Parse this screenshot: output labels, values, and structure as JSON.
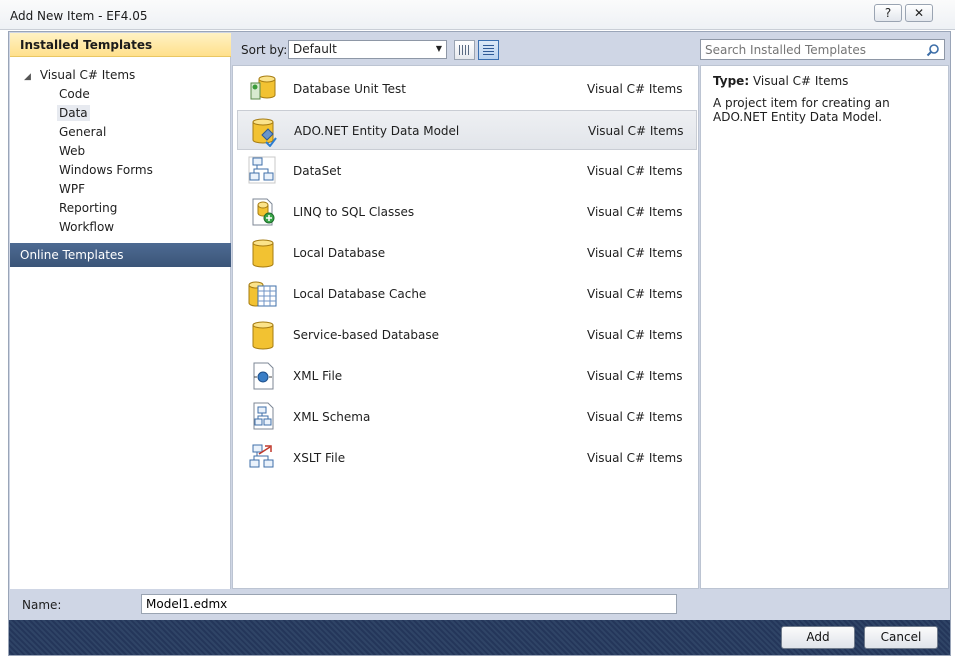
{
  "window": {
    "title": "Add New Item - EF4.05",
    "help_glyph": "?",
    "close_glyph": "✕"
  },
  "left": {
    "installed_header": "Installed Templates",
    "root": "Visual C# Items",
    "items": [
      "Code",
      "Data",
      "General",
      "Web",
      "Windows Forms",
      "WPF",
      "Reporting",
      "Workflow"
    ],
    "selected_item": "Data",
    "online": "Online Templates"
  },
  "toolbar": {
    "sort_label": "Sort by:",
    "sort_value": "Default"
  },
  "search": {
    "placeholder": "Search Installed Templates"
  },
  "templates": [
    {
      "name": "Database Unit Test",
      "category": "Visual C# Items",
      "icon": "database-unit-test-icon"
    },
    {
      "name": "ADO.NET Entity Data Model",
      "category": "Visual C# Items",
      "icon": "entity-data-model-icon"
    },
    {
      "name": "DataSet",
      "category": "Visual C# Items",
      "icon": "dataset-icon"
    },
    {
      "name": "LINQ to SQL Classes",
      "category": "Visual C# Items",
      "icon": "linq-to-sql-icon"
    },
    {
      "name": "Local Database",
      "category": "Visual C# Items",
      "icon": "local-database-icon"
    },
    {
      "name": "Local Database Cache",
      "category": "Visual C# Items",
      "icon": "local-database-cache-icon"
    },
    {
      "name": "Service-based Database",
      "category": "Visual C# Items",
      "icon": "service-database-icon"
    },
    {
      "name": "XML File",
      "category": "Visual C# Items",
      "icon": "xml-file-icon"
    },
    {
      "name": "XML Schema",
      "category": "Visual C# Items",
      "icon": "xml-schema-icon"
    },
    {
      "name": "XSLT File",
      "category": "Visual C# Items",
      "icon": "xslt-file-icon"
    }
  ],
  "selected_template": "ADO.NET Entity Data Model",
  "details": {
    "type_label": "Type:",
    "type_value": "Visual C# Items",
    "description": "A project item for creating an ADO.NET Entity Data Model."
  },
  "bottom": {
    "name_label": "Name:",
    "name_value": "Model1.edmx",
    "add_label": "Add",
    "cancel_label": "Cancel"
  },
  "colors": {
    "accent_header": "#ffe08c",
    "online_bg": "#3b5578",
    "footer_bg": "#2f4466"
  }
}
